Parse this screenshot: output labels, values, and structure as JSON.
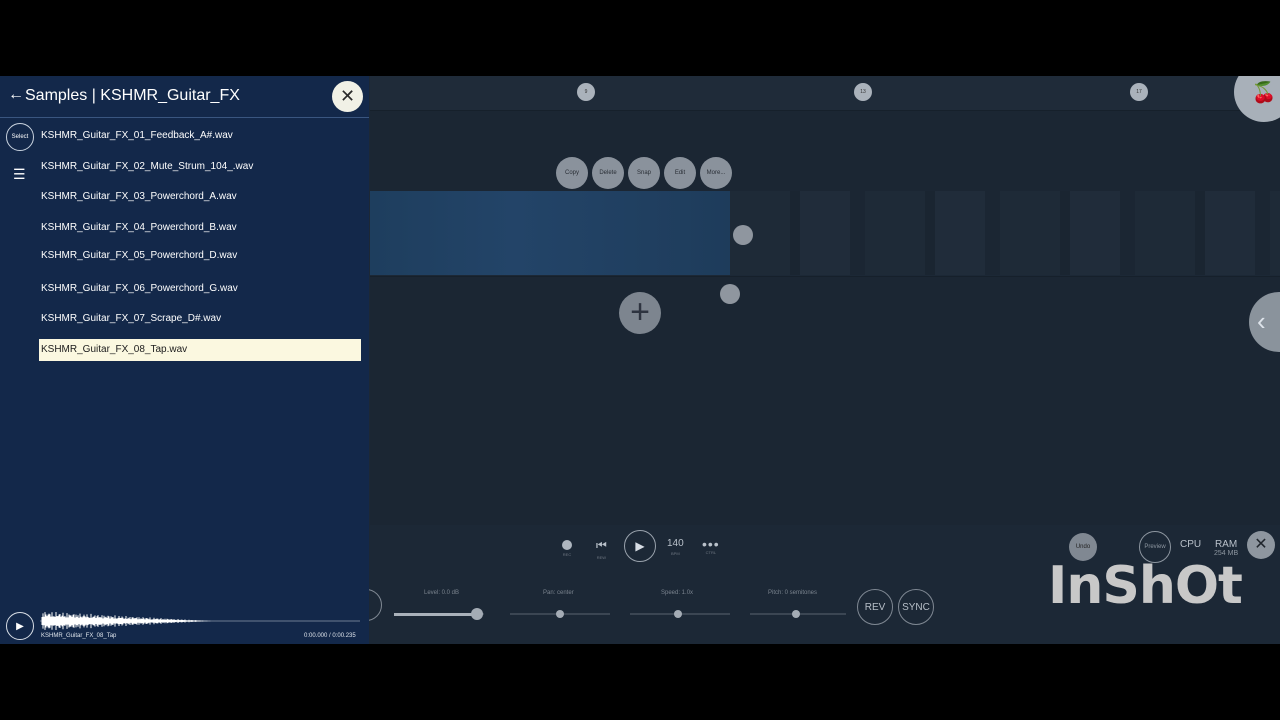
{
  "browser": {
    "back_icon": "arrow-left-icon",
    "title": "Samples | KSHMR_Guitar_FX",
    "select_label": "Select",
    "files": [
      "KSHMR_Guitar_FX_01_Feedback_A#.wav",
      "KSHMR_Guitar_FX_02_Mute_Strum_104_.wav",
      "KSHMR_Guitar_FX_03_Powerchord_A.wav",
      "KSHMR_Guitar_FX_04_Powerchord_B.wav",
      "KSHMR_Guitar_FX_05_Powerchord_D.wav",
      "KSHMR_Guitar_FX_06_Powerchord_G.wav",
      "KSHMR_Guitar_FX_07_Scrape_D#.wav",
      "KSHMR_Guitar_FX_08_Tap.wav"
    ],
    "selected_index": 7,
    "player": {
      "name": "KSHMR_Guitar_FX_08_Tap",
      "time": "0:00.000 / 0:00.235"
    }
  },
  "ruler": {
    "markers": [
      "9",
      "13",
      "17"
    ]
  },
  "context_menu": [
    "Copy",
    "Delete",
    "Snap",
    "Edit",
    "More..."
  ],
  "transport": {
    "rec_sub": "REC",
    "rew_sub": "REW",
    "bpm": "140",
    "bpm_sub": "BPM",
    "ctrl_sub": "CTRL",
    "undo": "Undo",
    "preview": "Preview",
    "cpu": "CPU",
    "ram": "RAM",
    "ram_value": "254 MB"
  },
  "mixer": {
    "level": "Level: 0.0 dB",
    "pan": "Pan: center",
    "speed": "Speed: 1.0x",
    "pitch": "Pitch: 0 semitones",
    "rev": "REV",
    "sync": "SYNC"
  },
  "watermark": "InShOt",
  "colors": {
    "panel": "#13284a",
    "selected_row": "#fbf8e0",
    "workspace": "#1c2836"
  }
}
